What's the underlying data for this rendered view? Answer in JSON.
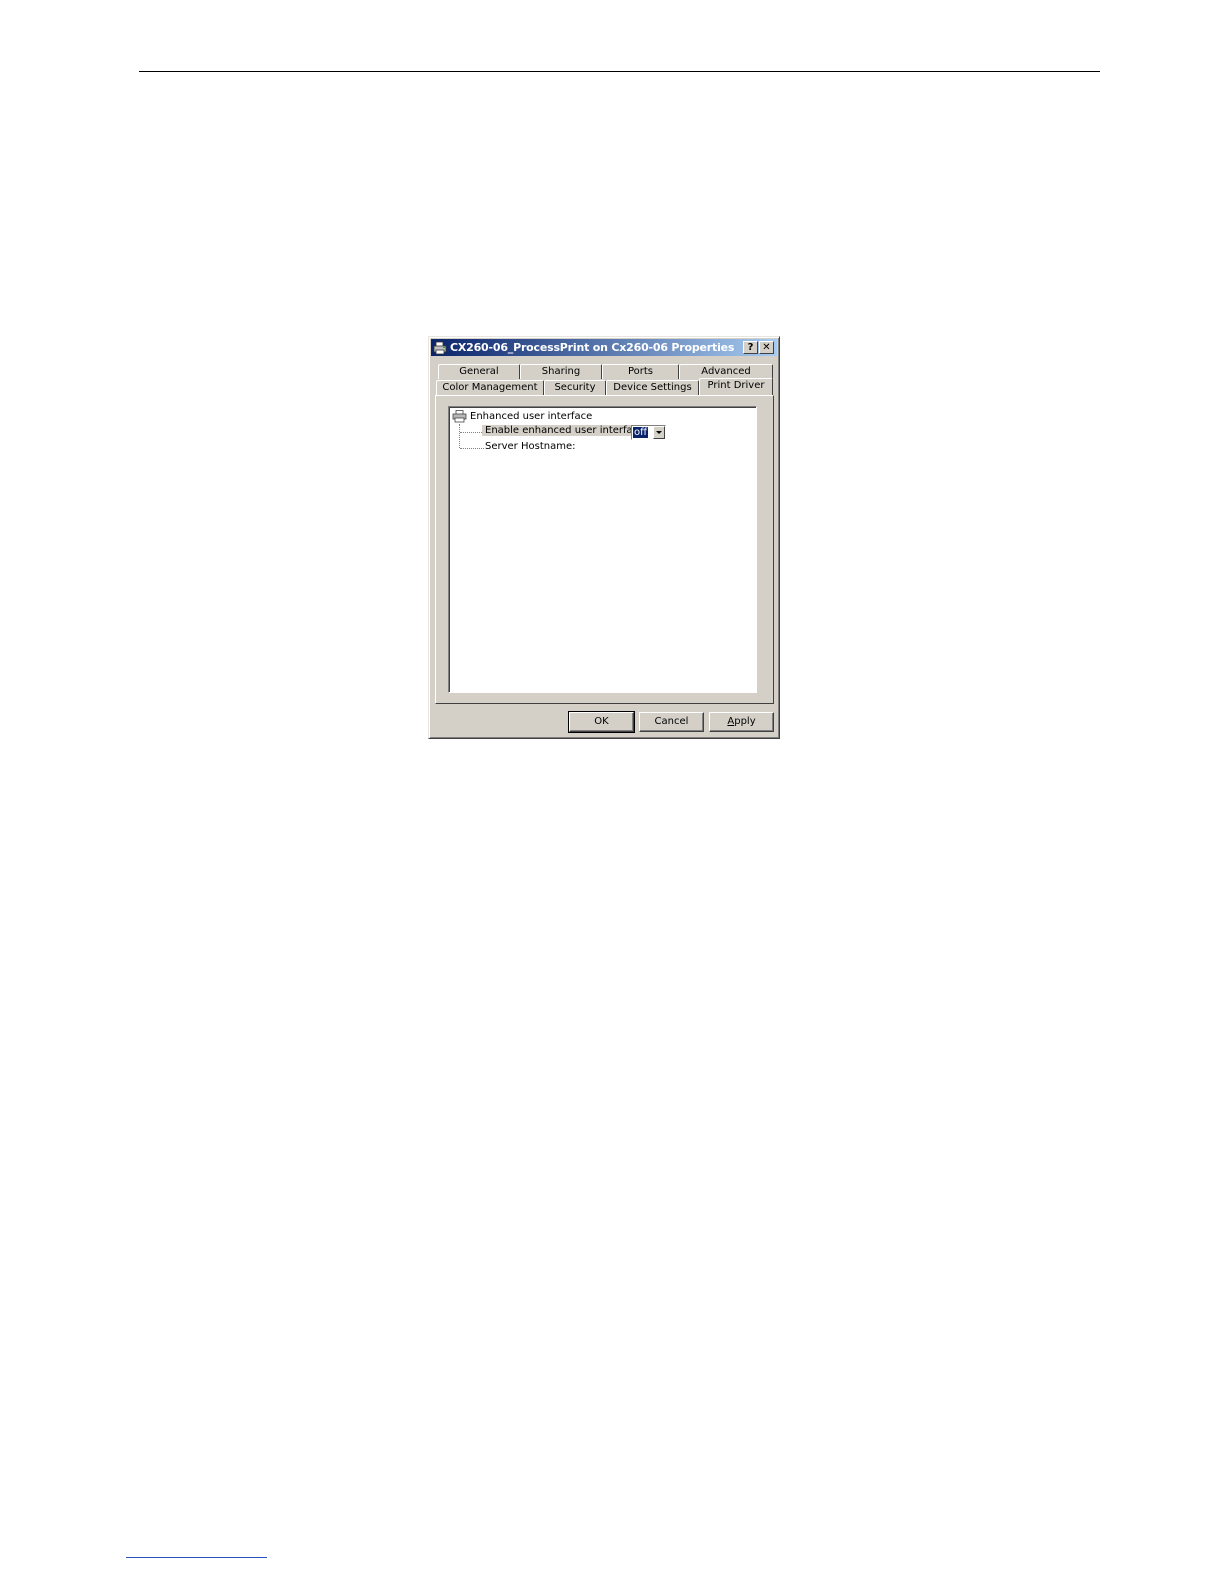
{
  "dialog": {
    "title": "CX260-06_ProcessPrint on Cx260-06 Properties",
    "title_icon": "printer-icon",
    "help_label": "?",
    "close_label": "✕"
  },
  "tabs": {
    "row_back": [
      {
        "label": "General"
      },
      {
        "label": "Sharing"
      },
      {
        "label": "Ports"
      },
      {
        "label": "Advanced"
      }
    ],
    "row_front": [
      {
        "label": "Color Management"
      },
      {
        "label": "Security"
      },
      {
        "label": "Device Settings"
      },
      {
        "label": "Print Driver",
        "active": true
      }
    ]
  },
  "tree": {
    "root_label": "Enhanced user interface",
    "root_icon": "printer-settings-icon",
    "items": [
      {
        "label": "Enable enhanced user interface:",
        "selected": true
      },
      {
        "label": "Server Hostname:"
      }
    ],
    "combo_value": "off"
  },
  "buttons": {
    "ok": "OK",
    "cancel": "Cancel",
    "apply_first": "A",
    "apply_rest": "pply"
  }
}
